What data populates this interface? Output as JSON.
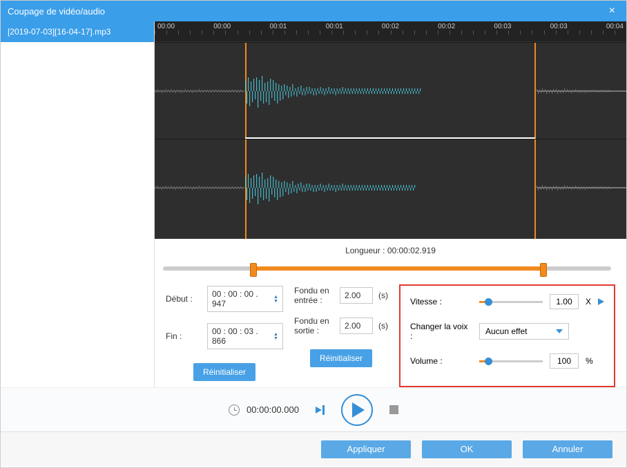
{
  "title": "Coupage de vidéo/audio",
  "file_item": "[2019-07-03][16-04-17].mp3",
  "ruler_times": [
    "00:00",
    "00:00",
    "00:01",
    "00:01",
    "00:02",
    "00:02",
    "00:03",
    "00:03",
    "00:04"
  ],
  "length_label": "Longueur :",
  "length_value": "00:00:02.919",
  "trim": {
    "start_label": "Début :",
    "start_value": "00 : 00 : 00 . 947",
    "end_label": "Fin :",
    "end_value": "00 : 00 : 03 . 866",
    "reset": "Réinitialiser"
  },
  "fade": {
    "in_label": "Fondu en entrée :",
    "in_value": "2.00",
    "out_label": "Fondu en sortie :",
    "out_value": "2.00",
    "unit": "(s)",
    "reset": "Réinitialiser"
  },
  "right": {
    "speed_label": "Vitesse :",
    "speed_value": "1.00",
    "speed_unit": "X",
    "voice_label": "Changer la voix :",
    "voice_value": "Aucun effet",
    "volume_label": "Volume :",
    "volume_value": "100",
    "volume_unit": "%"
  },
  "player_time": "00:00:00.000",
  "footer": {
    "apply": "Appliquer",
    "ok": "OK",
    "cancel": "Annuler"
  }
}
